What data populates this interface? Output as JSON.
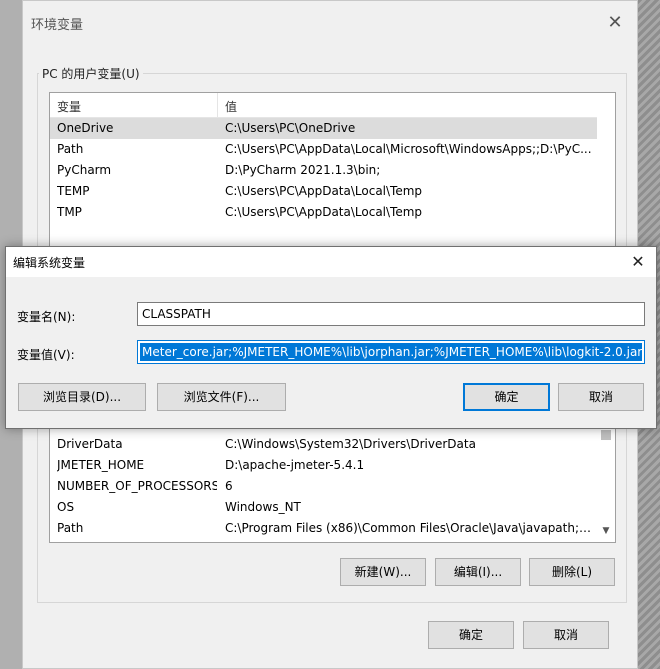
{
  "env_window": {
    "title": "环境变量",
    "user_group_label": "PC 的用户变量(U)",
    "columns": [
      "变量",
      "值"
    ],
    "user_vars": [
      {
        "name": "OneDrive",
        "value": "C:\\Users\\PC\\OneDrive",
        "selected": true
      },
      {
        "name": "Path",
        "value": "C:\\Users\\PC\\AppData\\Local\\Microsoft\\WindowsApps;;D:\\PyC...",
        "selected": false
      },
      {
        "name": "PyCharm",
        "value": "D:\\PyCharm 2021.1.3\\bin;",
        "selected": false
      },
      {
        "name": "TEMP",
        "value": "C:\\Users\\PC\\AppData\\Local\\Temp",
        "selected": false
      },
      {
        "name": "TMP",
        "value": "C:\\Users\\PC\\AppData\\Local\\Temp",
        "selected": false
      }
    ],
    "system_vars": [
      {
        "name": "DriverData",
        "value": "C:\\Windows\\System32\\Drivers\\DriverData"
      },
      {
        "name": "JMETER_HOME",
        "value": "D:\\apache-jmeter-5.4.1"
      },
      {
        "name": "NUMBER_OF_PROCESSORS",
        "value": "6"
      },
      {
        "name": "OS",
        "value": "Windows_NT"
      },
      {
        "name": "Path",
        "value": "C:\\Program Files (x86)\\Common Files\\Oracle\\Java\\javapath;C:..."
      }
    ],
    "buttons": {
      "new": "新建(W)...",
      "edit": "编辑(I)...",
      "delete": "删除(L)",
      "ok": "确定",
      "cancel": "取消"
    }
  },
  "edit_dialog": {
    "title": "编辑系统变量",
    "name_label": "变量名(N):",
    "name_value": "CLASSPATH",
    "value_label": "变量值(V):",
    "value_value": "Meter_core.jar;%JMETER_HOME%\\lib\\jorphan.jar;%JMETER_HOME%\\lib\\logkit-2.0.jar;",
    "buttons": {
      "browse_dir": "浏览目录(D)...",
      "browse_file": "浏览文件(F)...",
      "ok": "确定",
      "cancel": "取消"
    }
  }
}
